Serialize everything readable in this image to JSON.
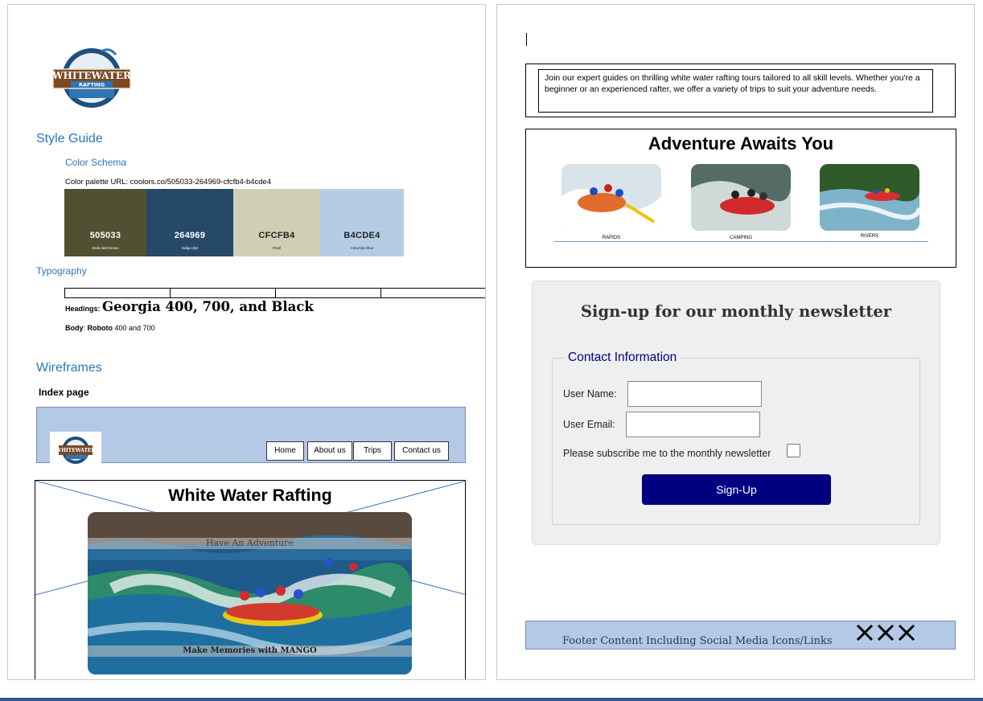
{
  "page1": {
    "logo": {
      "line1": "WHITEWATER",
      "line2": "RAFTING"
    },
    "style_guide_heading": "Style Guide",
    "color_schema_heading": "Color Schema",
    "palette_url": "Color palette URL: coolors.co/505033-264969-cfcfb4-b4cde4",
    "swatches": [
      {
        "code": "505033",
        "name": "Drab dark brown",
        "color": "#505033",
        "text_color": "#ffffff"
      },
      {
        "code": "264969",
        "name": "Indigo dye",
        "color": "#264969",
        "text_color": "#ffffff"
      },
      {
        "code": "CFCFB4",
        "name": "Pearl",
        "color": "#CFCFB4",
        "text_color": "#222222"
      },
      {
        "code": "B4CDE4",
        "name": "Columbia blue",
        "color": "#B4CDE4",
        "text_color": "#222222"
      }
    ],
    "typography_heading": "Typography",
    "headings_label": "Headings:",
    "headings_font": "Georgia 400, 700, and Black",
    "body_label": "Body",
    "body_sep": ": ",
    "body_font": "Roboto",
    "body_weights": " 400 and 700",
    "wireframes_heading": "Wireframes",
    "index_page_label": "Index page",
    "nav": [
      "Home",
      "About us",
      "Trips",
      "Contact us"
    ],
    "hero_title": "White Water Rafting",
    "hero_band_top": "Have An Adventure",
    "hero_band_bottom": "Make Memories with MANGO"
  },
  "page2": {
    "intro_text": "Join our expert guides on thrilling white water rafting tours tailored to all skill levels. Whether you're a beginner or an experienced rafter, we offer a variety of trips to suit your adventure needs.",
    "adventure_title": "Adventure Awaits You",
    "thumbs": [
      "RAPIDS",
      "CAMPING",
      "RIVERS"
    ],
    "newsletter_title": "Sign-up for our monthly newsletter",
    "legend": "Contact Information",
    "user_name_label": "User Name:",
    "user_email_label": "User Email:",
    "subscribe_label": "Please subscribe me to the monthly newsletter",
    "signup_button": "Sign-Up",
    "footer_text": "Footer Content Including Social Media Icons/Links",
    "footer_icons": "XXX"
  }
}
